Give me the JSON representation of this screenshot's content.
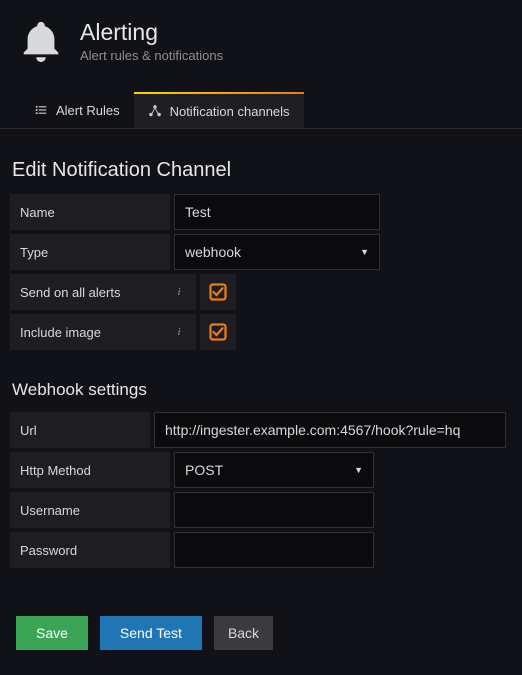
{
  "header": {
    "title": "Alerting",
    "subtitle": "Alert rules & notifications"
  },
  "tabs": {
    "rules": {
      "label": "Alert Rules"
    },
    "channels": {
      "label": "Notification channels"
    }
  },
  "section": {
    "title": "Edit Notification Channel",
    "sub": "Webhook settings"
  },
  "labels": {
    "name": "Name",
    "type": "Type",
    "send_on_all": "Send on all alerts",
    "include_image": "Include image",
    "url": "Url",
    "http_method": "Http Method",
    "username": "Username",
    "password": "Password"
  },
  "values": {
    "name": "Test",
    "type": "webhook",
    "send_on_all": true,
    "include_image": true,
    "url": "http://ingester.example.com:4567/hook?rule=hq",
    "http_method": "POST",
    "username": "",
    "password": ""
  },
  "buttons": {
    "save": "Save",
    "send_test": "Send Test",
    "back": "Back"
  }
}
